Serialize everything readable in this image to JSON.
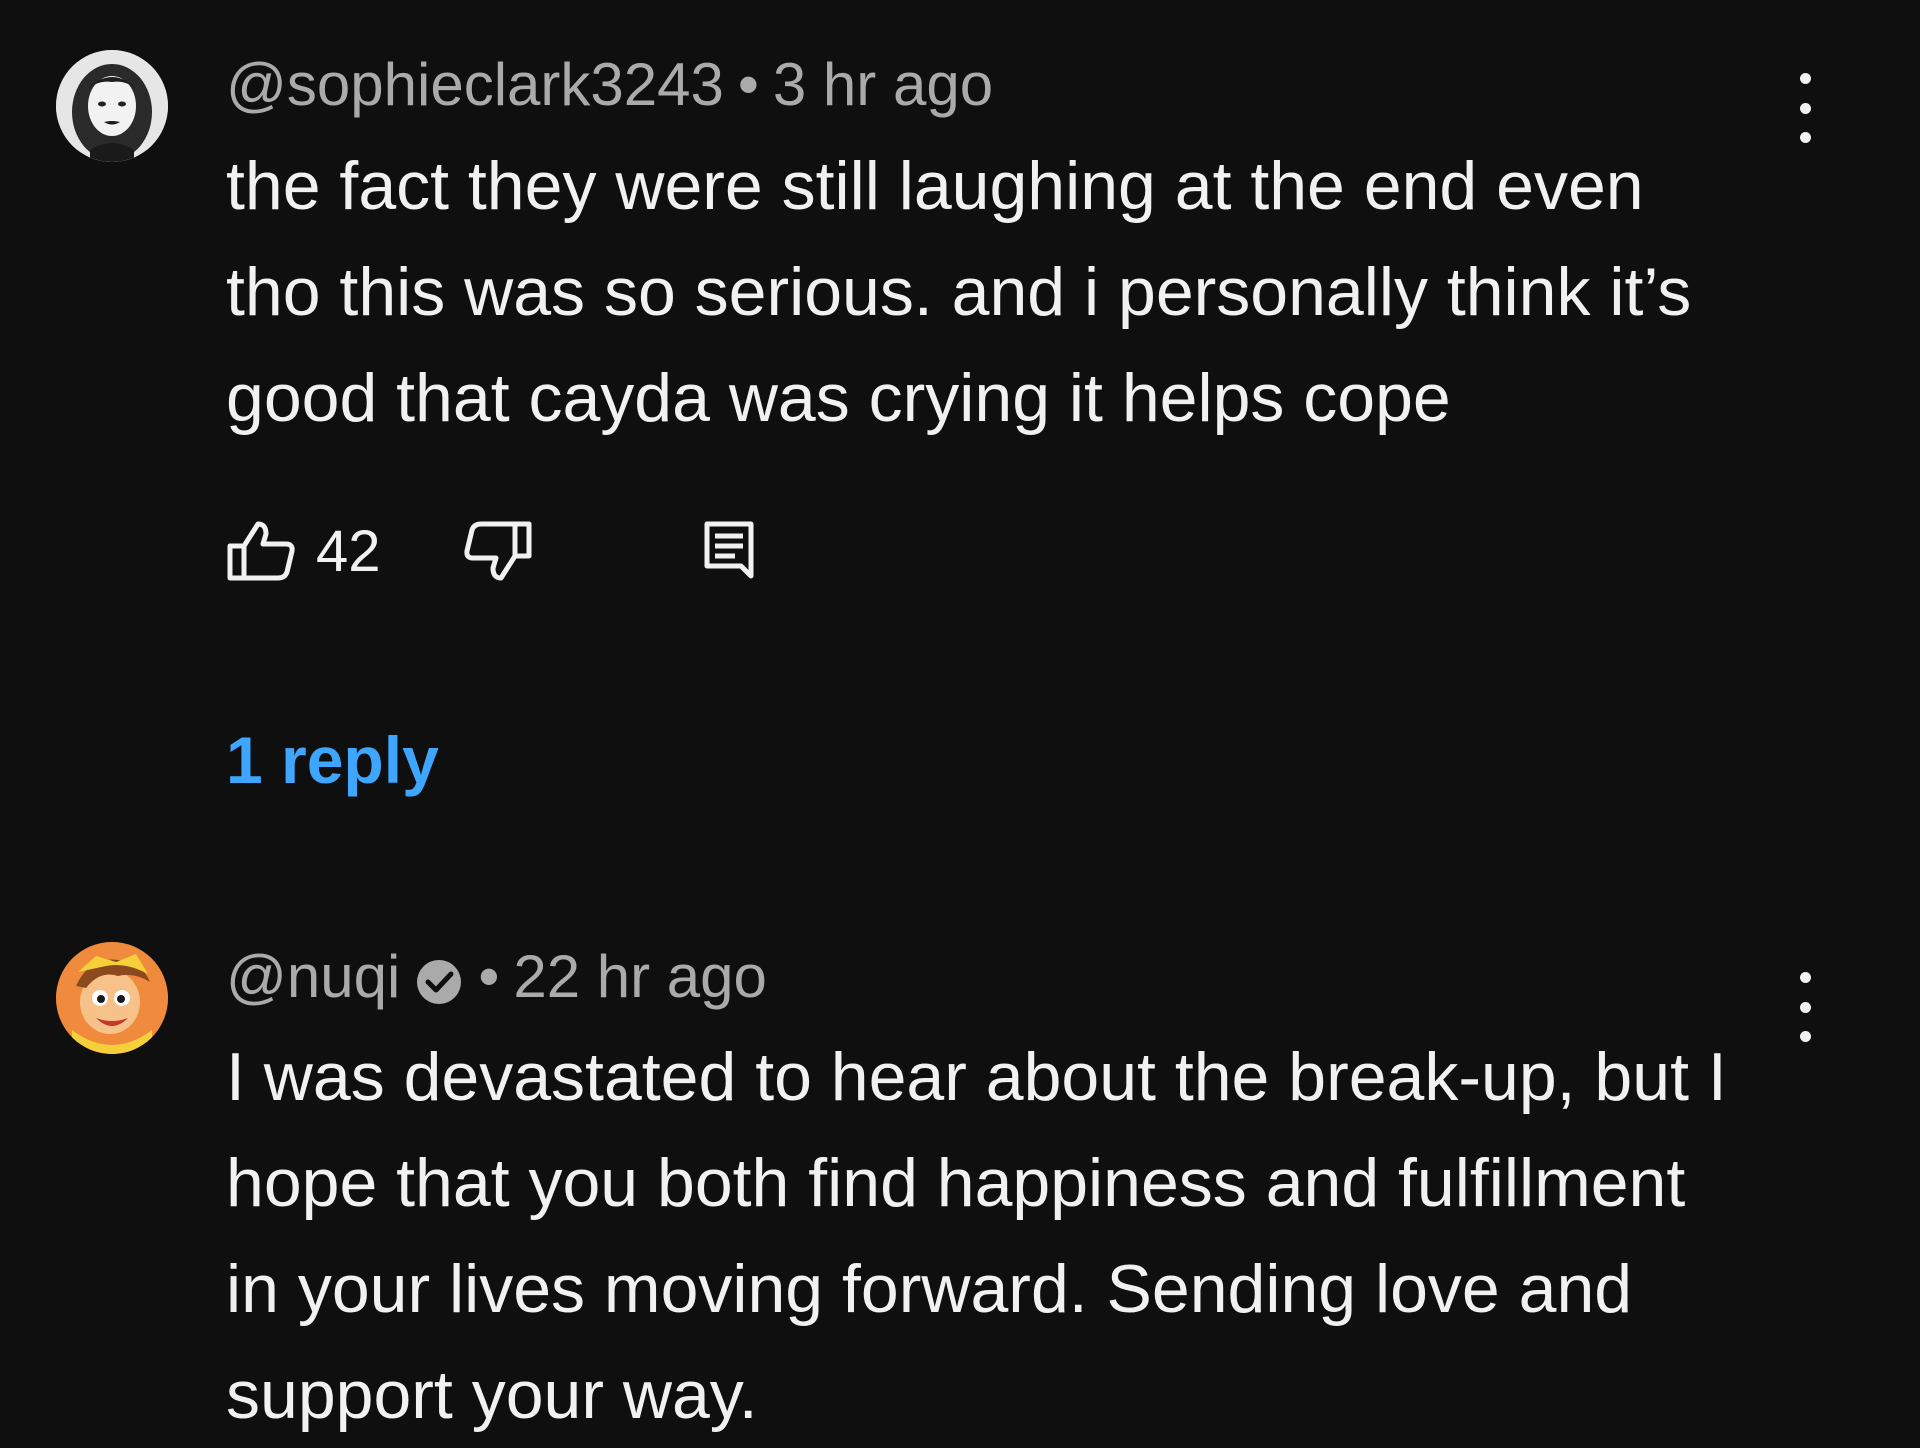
{
  "comments": [
    {
      "author": "@sophieclark3243",
      "separator": "•",
      "time": "3 hr ago",
      "avatar_icon": "user-photo-avatar",
      "text_lines": [
        "the fact they were still laughing at the end even",
        "tho this was so serious. and i personally think it’s",
        "good that cayda was crying it helps cope"
      ],
      "likes": "42",
      "replies_label": "1 reply"
    },
    {
      "author": "@nuqi",
      "verified": true,
      "separator": "•",
      "time": "22 hr ago",
      "avatar_icon": "cartoon-character-avatar",
      "text_lines": [
        "I was devastated to hear about the break-up, but I",
        "hope that you both find happiness and fulfillment",
        "in your lives moving forward. Sending love and",
        "support your way."
      ]
    }
  ],
  "icons": {
    "like": "thumbs-up-icon",
    "dislike": "thumbs-down-icon",
    "reply": "reply-comment-icon",
    "more": "vertical-ellipsis-icon",
    "verified": "verified-check-icon"
  },
  "colors": {
    "background": "#0f0f0f",
    "text": "#f1f1f1",
    "secondary_text": "#aaaaaa",
    "link": "#3ea6ff",
    "avatar2_bg": "#f08a3c"
  }
}
